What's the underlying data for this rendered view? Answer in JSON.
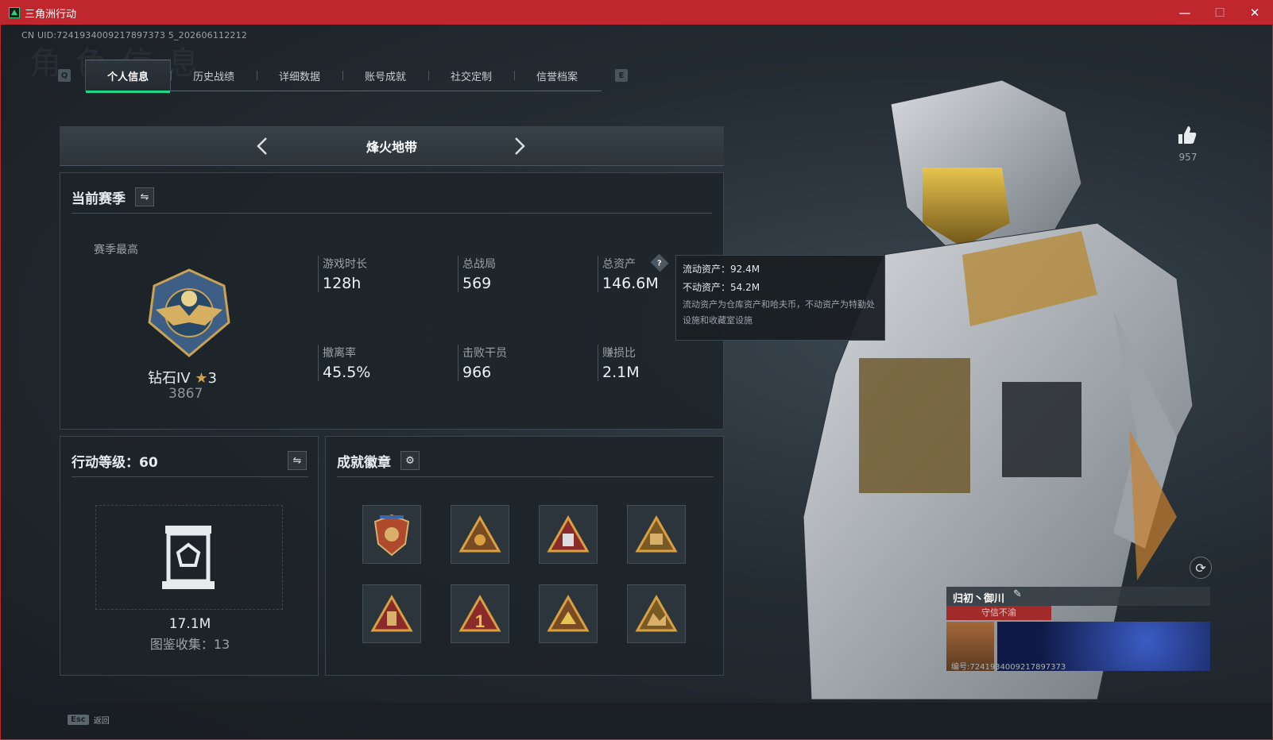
{
  "window": {
    "title": "三角洲行动",
    "min": "—",
    "max": "☐",
    "close": "✕"
  },
  "uid": "CN UID:7241934009217897373 5_202606112212",
  "bg_title": "角色信息",
  "tabs": {
    "left_key": "Q",
    "right_key": "E",
    "items": [
      "个人信息",
      "历史战绩",
      "详细数据",
      "账号成就",
      "社交定制",
      "信誉档案"
    ]
  },
  "mode": {
    "name": "烽火地带"
  },
  "season": {
    "title": "当前赛季",
    "best_label": "赛季最高",
    "rank": "钻石IV",
    "stars": "3",
    "score": "3867",
    "stats": [
      {
        "label": "游戏时长",
        "value": "128h"
      },
      {
        "label": "总战局",
        "value": "569"
      },
      {
        "label": "总资产",
        "value": "146.6M"
      },
      {
        "label": "撤离率",
        "value": "45.5%"
      },
      {
        "label": "击败干员",
        "value": "966"
      },
      {
        "label": "赚损比",
        "value": "2.1M"
      }
    ]
  },
  "tooltip": {
    "liquid": "流动资产：92.4M",
    "fixed": "不动资产：54.2M",
    "note": "流动资产为仓库资产和哈夫币，不动资产为特勤处设施和收藏室设施"
  },
  "level": {
    "title": "行动等级：60",
    "value": "17.1M",
    "collection": "图鉴收集：13"
  },
  "badges": {
    "title": "成就徽章",
    "items": [
      "badge-1",
      "badge-2",
      "badge-3",
      "badge-4",
      "badge-5",
      "badge-6",
      "badge-7",
      "badge-8"
    ]
  },
  "likes": {
    "count": "957"
  },
  "profile": {
    "name": "归初丶御川",
    "motto": "守信不渝",
    "id": "编号:7241934009217897373"
  },
  "footer": {
    "key": "Esc",
    "label": "返回"
  },
  "colors": {
    "accent": "#1fd889",
    "titlebar": "#c0262e",
    "gold": "#c9a253"
  }
}
